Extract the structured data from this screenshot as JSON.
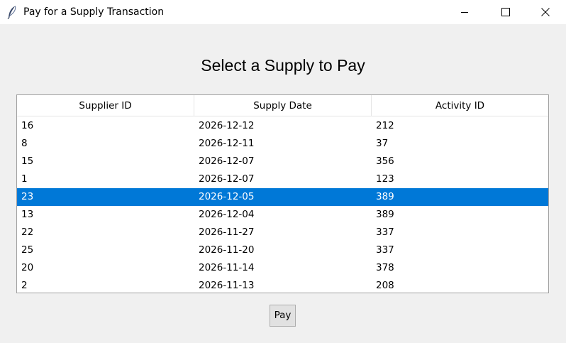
{
  "window": {
    "title": "Pay for a Supply Transaction",
    "controls": [
      "minimize-icon",
      "maximize-icon",
      "close-icon"
    ]
  },
  "heading": "Select a Supply to Pay",
  "table": {
    "columns": [
      "Supplier ID",
      "Supply Date",
      "Activity ID"
    ],
    "rows": [
      [
        "16",
        "2026-12-12",
        "212"
      ],
      [
        "8",
        "2026-12-11",
        "37"
      ],
      [
        "15",
        "2026-12-07",
        "356"
      ],
      [
        "1",
        "2026-12-07",
        "123"
      ],
      [
        "23",
        "2026-12-05",
        "389"
      ],
      [
        "13",
        "2026-12-04",
        "389"
      ],
      [
        "22",
        "2026-11-27",
        "337"
      ],
      [
        "25",
        "2026-11-20",
        "337"
      ],
      [
        "20",
        "2026-11-14",
        "378"
      ],
      [
        "2",
        "2026-11-13",
        "208"
      ]
    ],
    "selected_row_index": 4,
    "selection_color": "#0078d7"
  },
  "actions": {
    "pay_label": "Pay"
  }
}
